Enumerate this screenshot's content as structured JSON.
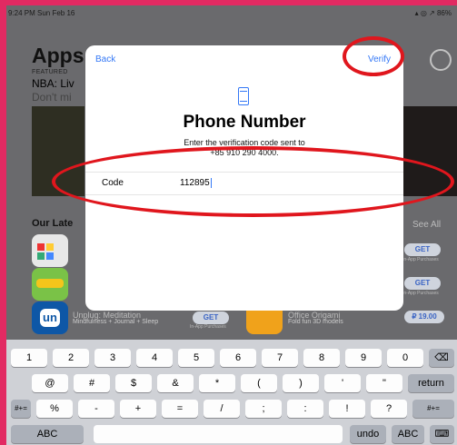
{
  "status_bar": {
    "time": "9:24 PM  Sun Feb 16",
    "right": "▴ ◎ ↗ 86%"
  },
  "background": {
    "title": "Apps",
    "featured": "FEATURED",
    "headline": "NBA: Liv",
    "subline": "Don't mi",
    "section": "Our Late",
    "see_all": "See All",
    "row1_get": "GET",
    "row1_note": "In-App Purchases",
    "row2_get": "GET",
    "row2_note": "In-App Purchases",
    "row3_title": "Unplug: Meditation",
    "row3_sub": "Mindfulness + Journal + Sleep",
    "row3_get": "GET",
    "row3_note": "In-App Purchases",
    "row3b_title": "Office Origami",
    "row3b_sub": "Fold fun 3D models",
    "row3b_price": "₽ 19.00"
  },
  "modal": {
    "back": "Back",
    "verify": "Verify",
    "title": "Phone Number",
    "subtitle": "Enter the verification code sent to",
    "phone": "+85 910 290 4000.",
    "code_label": "Code",
    "code_value": "112895"
  },
  "keyboard": {
    "row1": [
      "1",
      "2",
      "3",
      "4",
      "5",
      "6",
      "7",
      "8",
      "9",
      "0",
      "⌫"
    ],
    "row2": [
      "@",
      "#",
      "$",
      "&",
      "*",
      "(",
      ")",
      "'",
      "\"",
      "return"
    ],
    "row3": [
      "#+=",
      "%",
      "-",
      "+",
      "=",
      "/",
      ";",
      ":",
      "!",
      "?",
      "#+="
    ],
    "row4": [
      "ABC",
      "",
      "undo",
      "ABC",
      "⌨"
    ]
  }
}
